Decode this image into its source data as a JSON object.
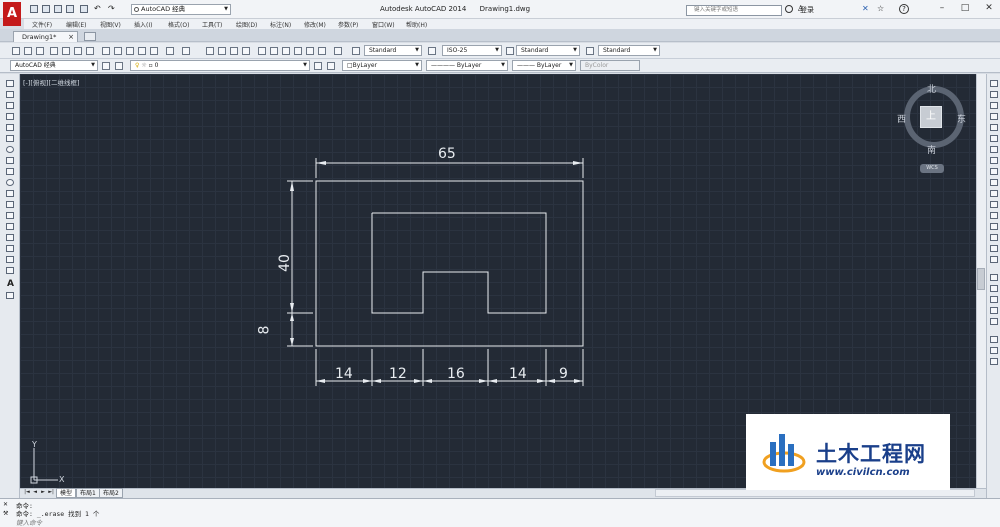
{
  "app": {
    "logo_letter": "A",
    "title": "Autodesk AutoCAD 2014",
    "file": "Drawing1.dwg"
  },
  "workspace": {
    "label": "AutoCAD 经典"
  },
  "search": {
    "placeholder": "键入关键字或短语"
  },
  "user": {
    "login": "登录"
  },
  "menu": [
    "文件(F)",
    "编辑(E)",
    "视图(V)",
    "插入(I)",
    "格式(O)",
    "工具(T)",
    "绘图(D)",
    "标注(N)",
    "修改(M)",
    "参数(P)",
    "窗口(W)",
    "帮助(H)"
  ],
  "tabs": {
    "doc": "Drawing1*"
  },
  "styles": {
    "text_style": "Standard",
    "dim_style": "ISO-25",
    "table_style": "Standard",
    "mleader_style": "Standard"
  },
  "layer_toolbar": {
    "workspace": "AutoCAD 经典",
    "layer": "0",
    "color": "ByLayer",
    "linetype": "ByLayer",
    "lineweight": "ByLayer",
    "plotstyle": "ByColor"
  },
  "viewport": {
    "label": "[-][俯视][二维线框]"
  },
  "viewcube": {
    "north": "北",
    "south": "南",
    "east": "东",
    "west": "西",
    "top": "上",
    "wcs": "WCS"
  },
  "ucs": {
    "y": "Y",
    "x": "X"
  },
  "drawing": {
    "dims": {
      "width": "65",
      "height": "40",
      "bottom": "8",
      "seg1": "14",
      "seg2": "12",
      "seg3": "16",
      "seg4": "14",
      "seg5": "9"
    },
    "colors": {
      "line": "#e8ecf0",
      "canvas": "#232a35"
    }
  },
  "layout_tabs": [
    "模型",
    "布局1",
    "布局2"
  ],
  "command": {
    "line1": "命令:",
    "line2": "命令: _.erase 找到 1 个",
    "prompt": "键入命令"
  },
  "watermark": {
    "name": "土木工程网",
    "url": "www.civilcn.com"
  }
}
